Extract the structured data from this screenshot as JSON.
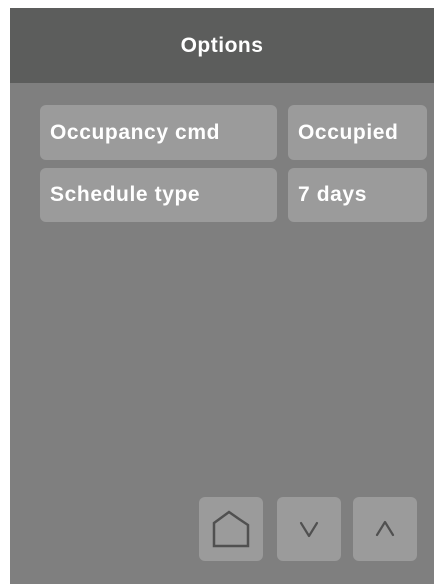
{
  "header": {
    "title": "Options"
  },
  "rows": [
    {
      "label": "Occupancy cmd",
      "value": "Occupied"
    },
    {
      "label": "Schedule type",
      "value": "7 days"
    }
  ],
  "nav": {
    "home_icon": "home-icon",
    "down_icon": "chevron-down-icon",
    "up_icon": "chevron-up-icon"
  },
  "colors": {
    "background": "#7f7f7f",
    "header": "#5c5d5c",
    "tile": "#9b9b9b",
    "text": "#ffffff",
    "icon": "#505050"
  }
}
